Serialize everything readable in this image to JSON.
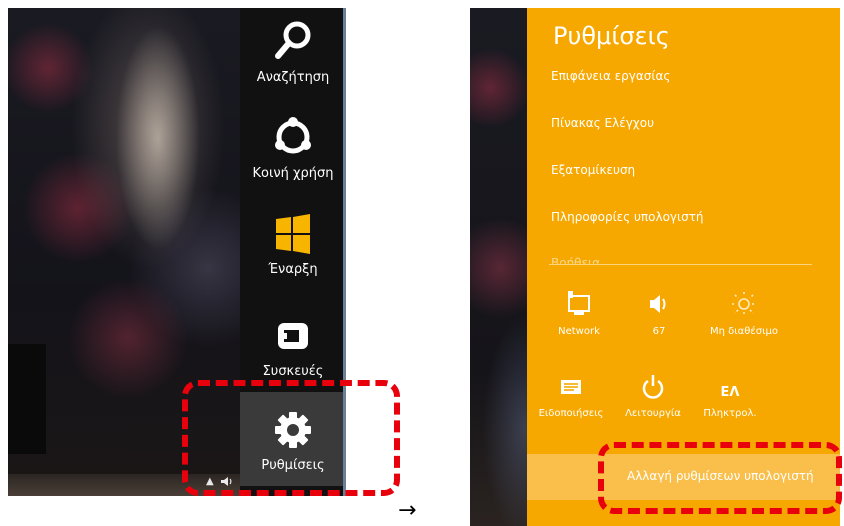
{
  "colors": {
    "charm_bar_bg": "#111111",
    "charm_active_bg": "#3a3a3a",
    "settings_accent": "#f7a800",
    "settings_selected": "#f9bf4a",
    "highlight": "#e8000c",
    "windows_logo": "#f7b500"
  },
  "left_screen": {
    "charms": [
      {
        "label": "Αναζήτηση",
        "icon": "search-icon"
      },
      {
        "label": "Κοινή χρήση",
        "icon": "share-icon"
      },
      {
        "label": "Έναρξη",
        "icon": "windows-start-icon"
      },
      {
        "label": "Συσκευές",
        "icon": "devices-icon"
      },
      {
        "label": "Ρυθμίσεις",
        "icon": "gear-icon",
        "highlighted": true
      }
    ],
    "tray": {
      "icons": [
        "tray-up-arrow-icon",
        "volume-icon"
      ]
    }
  },
  "arrow": "→",
  "right_screen": {
    "title": "Ρυθμίσεις",
    "links": [
      "Επιφάνεια εργασίας",
      "Πίνακας Ελέγχου",
      "Εξατομίκευση",
      "Πληροφορίες υπολογιστή",
      "Βοήθεια"
    ],
    "tiles_row1": [
      {
        "label": "Network",
        "icon": "network-icon"
      },
      {
        "label": "67",
        "icon": "volume-icon"
      },
      {
        "label": "Μη διαθέσιμο",
        "icon": "brightness-icon",
        "disabled": true
      }
    ],
    "tiles_row2": [
      {
        "label": "Ειδοποιήσεις",
        "icon": "notifications-icon"
      },
      {
        "label": "Λειτουργία",
        "icon": "power-icon"
      },
      {
        "label": "Πληκτρολ.",
        "icon": "keyboard-icon",
        "glyph": "ΕΛ"
      }
    ],
    "change_pc_settings": "Αλλαγή ρυθμίσεων υπολογιστή"
  }
}
